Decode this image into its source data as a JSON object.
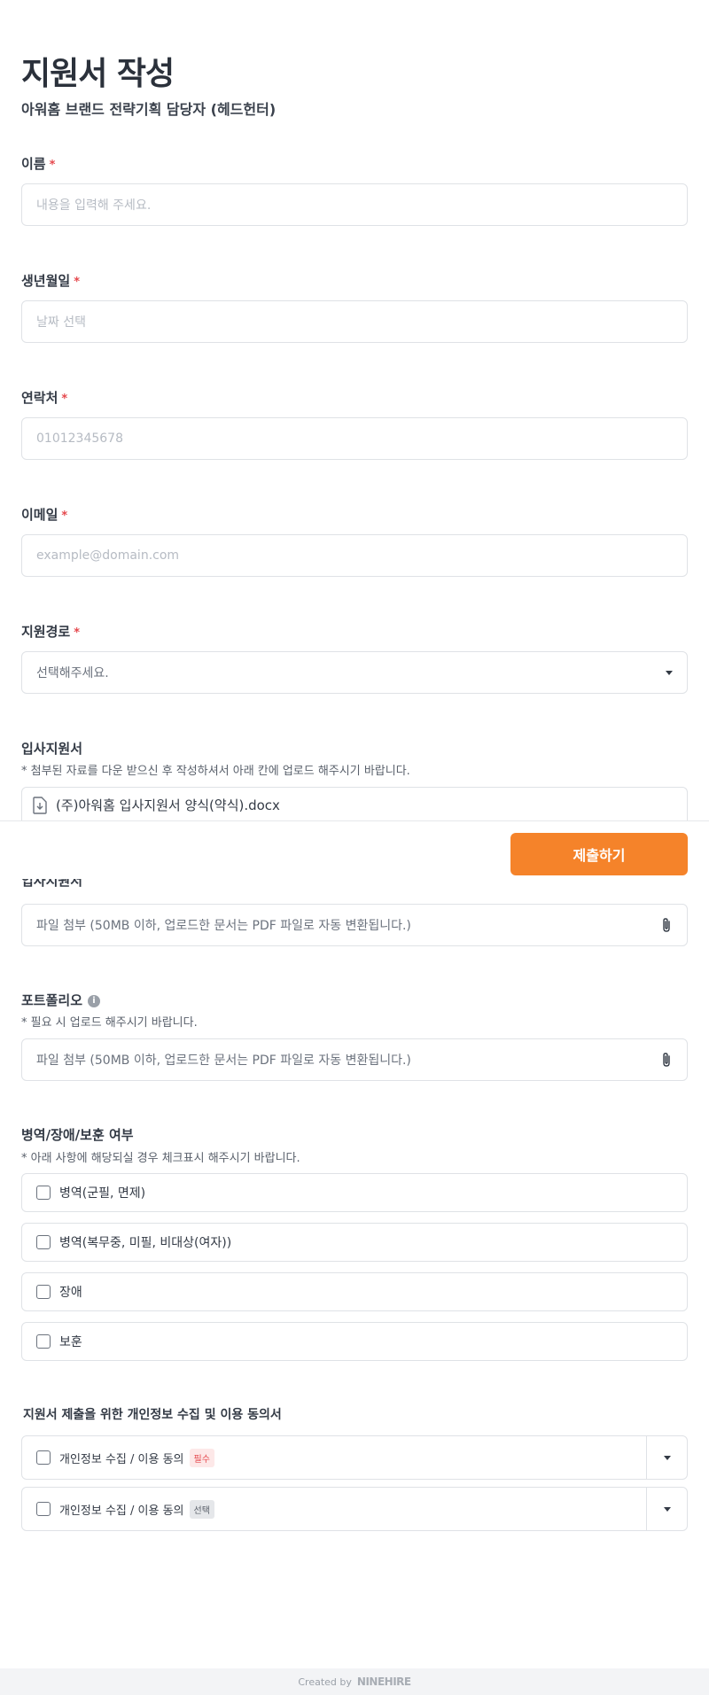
{
  "header": {
    "title": "지원서 작성",
    "subtitle": "아워홈 브랜드 전략기획 담당자 (헤드헌터)"
  },
  "fields": {
    "name": {
      "label": "이름",
      "required": "*",
      "placeholder": "내용을 입력해 주세요."
    },
    "birth": {
      "label": "생년월일",
      "required": "*",
      "placeholder": "날짜 선택"
    },
    "phone": {
      "label": "연락처",
      "required": "*",
      "placeholder": "01012345678"
    },
    "email": {
      "label": "이메일",
      "required": "*",
      "placeholder": "example@domain.com"
    },
    "source": {
      "label": "지원경로",
      "required": "*",
      "value": "선택해주세요."
    }
  },
  "application_form": {
    "label": "입사지원서",
    "note": "* 첨부된 자료를 다운 받으신 후 작성하셔서 아래 칸에 업로드 해주시기 바랍니다.",
    "attachment_name": "(주)아워홈 입사지원서 양식(약식).docx",
    "upload_placeholder": "파일 첨부 (50MB 이하, 업로드한 문서는 PDF 파일로 자동 변환됩니다.)"
  },
  "sticky_bar": {
    "submit_label": "제출하기"
  },
  "portfolio": {
    "label": "포트폴리오",
    "info_icon": "i",
    "note": "* 필요 시 업로드 해주시기 바랍니다.",
    "upload_placeholder": "파일 첨부 (50MB 이하, 업로드한 문서는 PDF 파일로 자동 변환됩니다.)"
  },
  "military": {
    "label": "병역/장애/보훈 여부",
    "note": "* 아래 사항에 해당되실 경우 체크표시 해주시기 바랍니다.",
    "options": [
      "병역(군필, 면제)",
      "병역(복무중, 미필, 비대상(여자))",
      "장애",
      "보훈"
    ]
  },
  "consent": {
    "title": "지원서 제출을 위한 개인정보 수집 및 이용 동의서",
    "items": [
      {
        "label": "개인정보 수집 / 이용 동의",
        "tag": "필수"
      },
      {
        "label": "개인정보 수집 / 이용 동의",
        "tag": "선택"
      }
    ]
  },
  "footer": {
    "created_by": "Created by",
    "brand": "NINEHIRE"
  },
  "colors": {
    "accent": "#f5832a",
    "required": "#e5484d",
    "border": "#dfe2e6"
  },
  "icons": [
    "download-file-icon",
    "paperclip-icon",
    "chevron-down-icon",
    "info-icon",
    "checkbox-icon"
  ]
}
